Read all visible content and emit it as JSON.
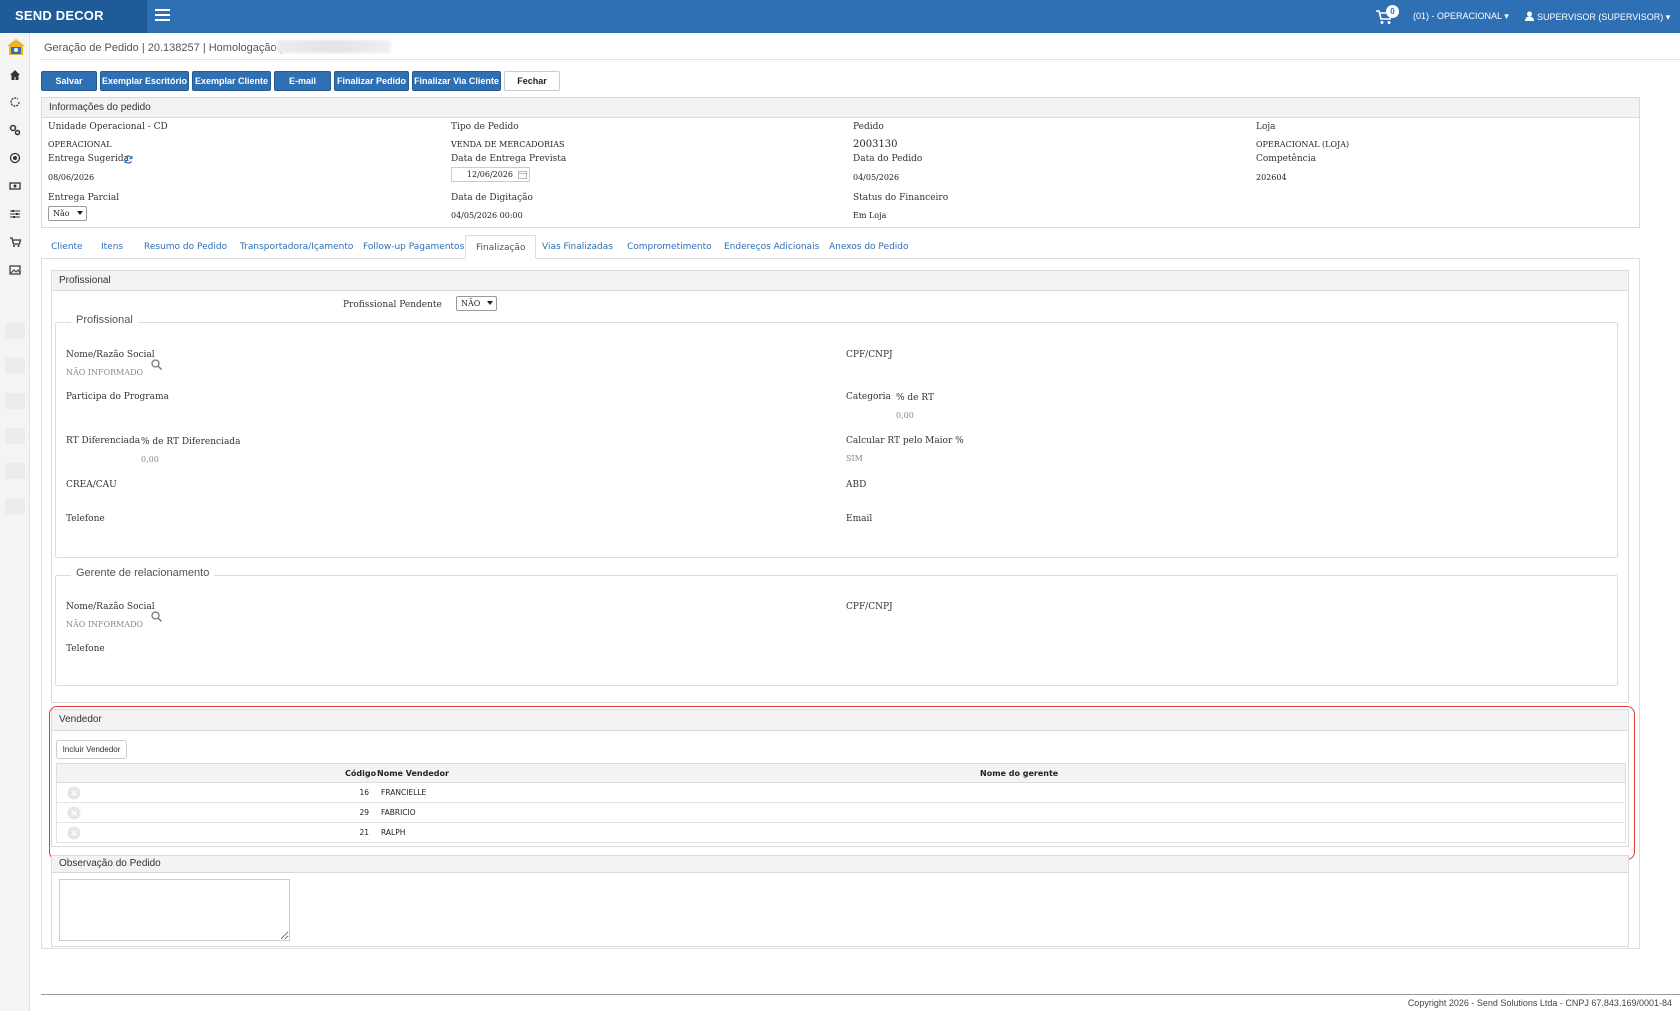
{
  "app": {
    "brand": "SEND DECOR"
  },
  "topbar": {
    "cart_count": "0",
    "unit_menu": "(01) - OPERACIONAL",
    "user_menu": "SUPERVISOR (SUPERVISOR)"
  },
  "header": {
    "title": "Geração de Pedido | 20.138257 | Homologação |"
  },
  "toolbar": {
    "salvar": "Salvar",
    "exemplar_escritorio": "Exemplar Escritório",
    "exemplar_cliente": "Exemplar Cliente",
    "email": "E-mail",
    "finalizar_pedido": "Finalizar Pedido",
    "finalizar_via_cliente": "Finalizar Via Cliente",
    "fechar": "Fechar"
  },
  "info": {
    "title": "Informações do pedido",
    "unidade_label": "Unidade Operacional - CD",
    "unidade_value": "OPERACIONAL",
    "tipo_label": "Tipo de Pedido",
    "tipo_value": "VENDA DE MERCADORIAS",
    "pedido_label": "Pedido",
    "pedido_value": "2003130",
    "loja_label": "Loja",
    "loja_value": "OPERACIONAL (LOJA)",
    "entrega_sugerida_label": "Entrega Sugerida",
    "entrega_sugerida_value": "08/06/2026",
    "entrega_prevista_label": "Data de Entrega Prevista",
    "entrega_prevista_value": "12/06/2026",
    "data_pedido_label": "Data do Pedido",
    "data_pedido_value": "04/05/2026",
    "competencia_label": "Competência",
    "competencia_value": "202604",
    "entrega_parcial_label": "Entrega Parcial",
    "entrega_parcial_value": "Não",
    "digitacao_label": "Data de Digitação",
    "digitacao_value": "04/05/2026 00:00",
    "status_fin_label": "Status do Financeiro",
    "status_fin_value": "Em Loja"
  },
  "tabs": [
    {
      "label": "Cliente"
    },
    {
      "label": "Itens"
    },
    {
      "label": "Resumo do Pedido"
    },
    {
      "label": "Transportadora/Içamento"
    },
    {
      "label": "Follow-up Pagamentos"
    },
    {
      "label": "Finalização"
    },
    {
      "label": "Vias Finalizadas"
    },
    {
      "label": "Comprometimento"
    },
    {
      "label": "Endereços Adicionais"
    },
    {
      "label": "Anexos do Pedido"
    }
  ],
  "profissional": {
    "panel_title": "Profissional",
    "pendente_label": "Profissional Pendente",
    "pendente_value": "NÃO",
    "group_title": "Profissional",
    "nome_label": "Nome/Razão Social",
    "nome_value": "NÃO INFORMADO",
    "cpf_label": "CPF/CNPJ",
    "programa_label": "Participa do Programa",
    "categoria_label": "Categoria",
    "rt_label": "% de RT",
    "rt_value": "0,00",
    "rt_dif_label": "RT Diferenciada",
    "rt_dif_pct_label": "% de RT Diferenciada",
    "rt_dif_value": "0,00",
    "calc_rt_label": "Calcular RT pelo Maior %",
    "calc_rt_value": "SIM",
    "crea_label": "CREA/CAU",
    "abd_label": "ABD",
    "telefone_label": "Telefone",
    "email_label": "Email"
  },
  "gerente": {
    "group_title": "Gerente de relacionamento",
    "nome_label": "Nome/Razão Social",
    "nome_value": "NÃO INFORMADO",
    "cpf_label": "CPF/CNPJ",
    "telefone_label": "Telefone"
  },
  "vendedor": {
    "panel_title": "Vendedor",
    "incluir_label": "Incluir Vendedor",
    "columns": [
      "Código",
      "Nome Vendedor",
      "Nome do gerente"
    ],
    "rows": [
      {
        "codigo": "16",
        "nome": "FRANCIELLE",
        "gerente": ""
      },
      {
        "codigo": "29",
        "nome": "FABRICIO",
        "gerente": ""
      },
      {
        "codigo": "21",
        "nome": "RALPH",
        "gerente": ""
      }
    ]
  },
  "observacao": {
    "panel_title": "Observação do Pedido",
    "value": ""
  },
  "footer": {
    "copyright": "Copyright 2026 - Send Solutions Ltda - CNPJ 67.843.169/0001-84"
  }
}
